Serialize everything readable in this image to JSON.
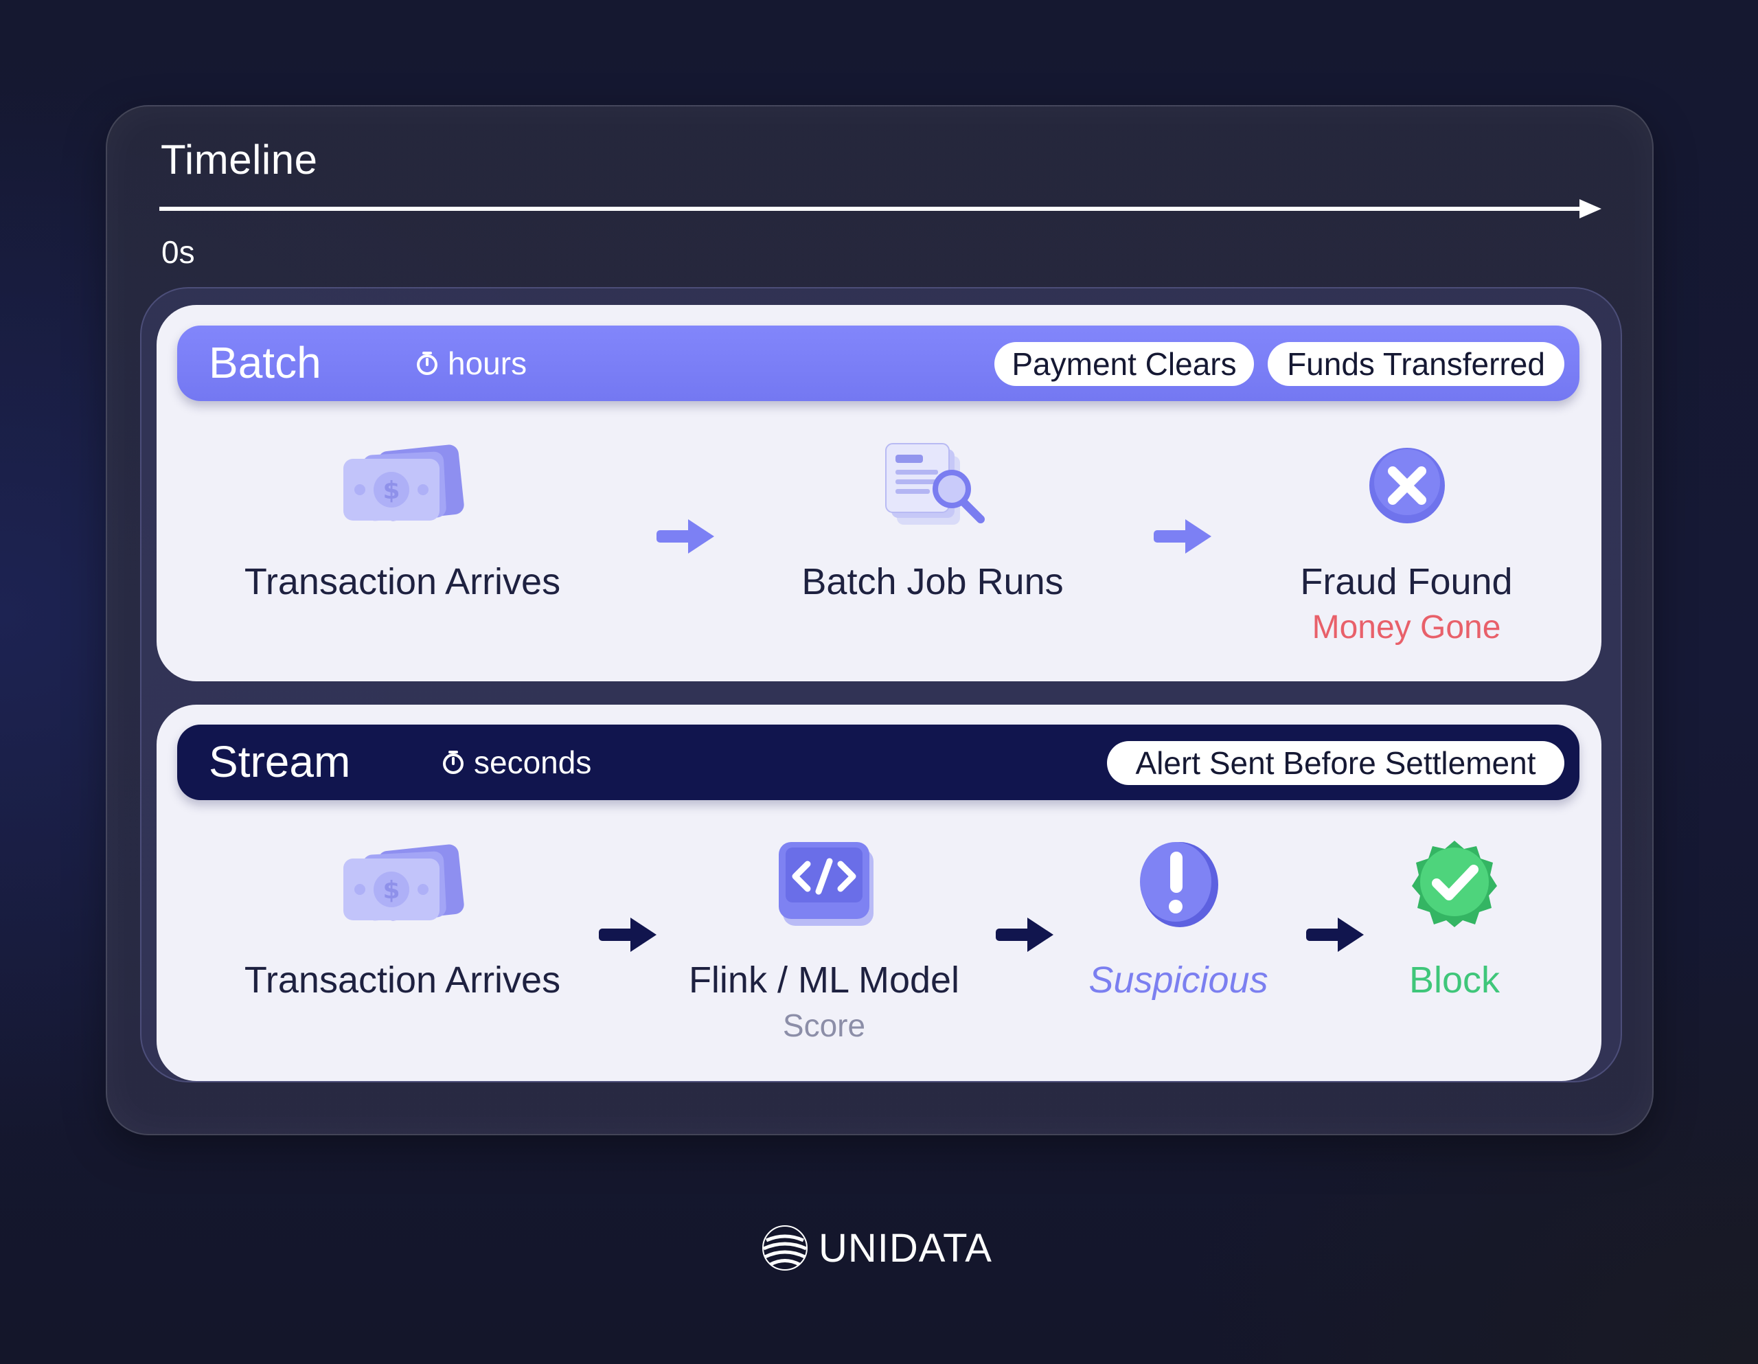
{
  "timeline": {
    "title": "Timeline",
    "start_label": "0s"
  },
  "batch": {
    "title": "Batch",
    "duration": "hours",
    "pills": [
      "Payment Clears",
      "Funds Transferred"
    ],
    "steps": [
      {
        "label": "Transaction Arrives",
        "icon": "money-stack-icon"
      },
      {
        "label": "Batch Job Runs",
        "icon": "document-search-icon"
      },
      {
        "label": "Fraud Found",
        "sublabel": "Money Gone",
        "icon": "x-circle-icon"
      }
    ]
  },
  "stream": {
    "title": "Stream",
    "duration": "seconds",
    "pills": [
      "Alert Sent Before Settlement"
    ],
    "steps": [
      {
        "label": "Transaction Arrives",
        "icon": "money-stack-icon"
      },
      {
        "label": "Flink / ML Model",
        "sublabel": "Score",
        "icon": "code-icon"
      },
      {
        "label": "Suspicious",
        "icon": "exclamation-icon"
      },
      {
        "label": "Block",
        "icon": "check-badge-icon"
      }
    ]
  },
  "brand": {
    "name": "UNIDATA"
  },
  "colors": {
    "batch_bar": "#7a7ef6",
    "stream_bar": "#11154e",
    "money_gone": "#e8606a",
    "suspicious": "#7b7ff0",
    "block": "#3fc67a",
    "score": "#8c8ea8"
  }
}
